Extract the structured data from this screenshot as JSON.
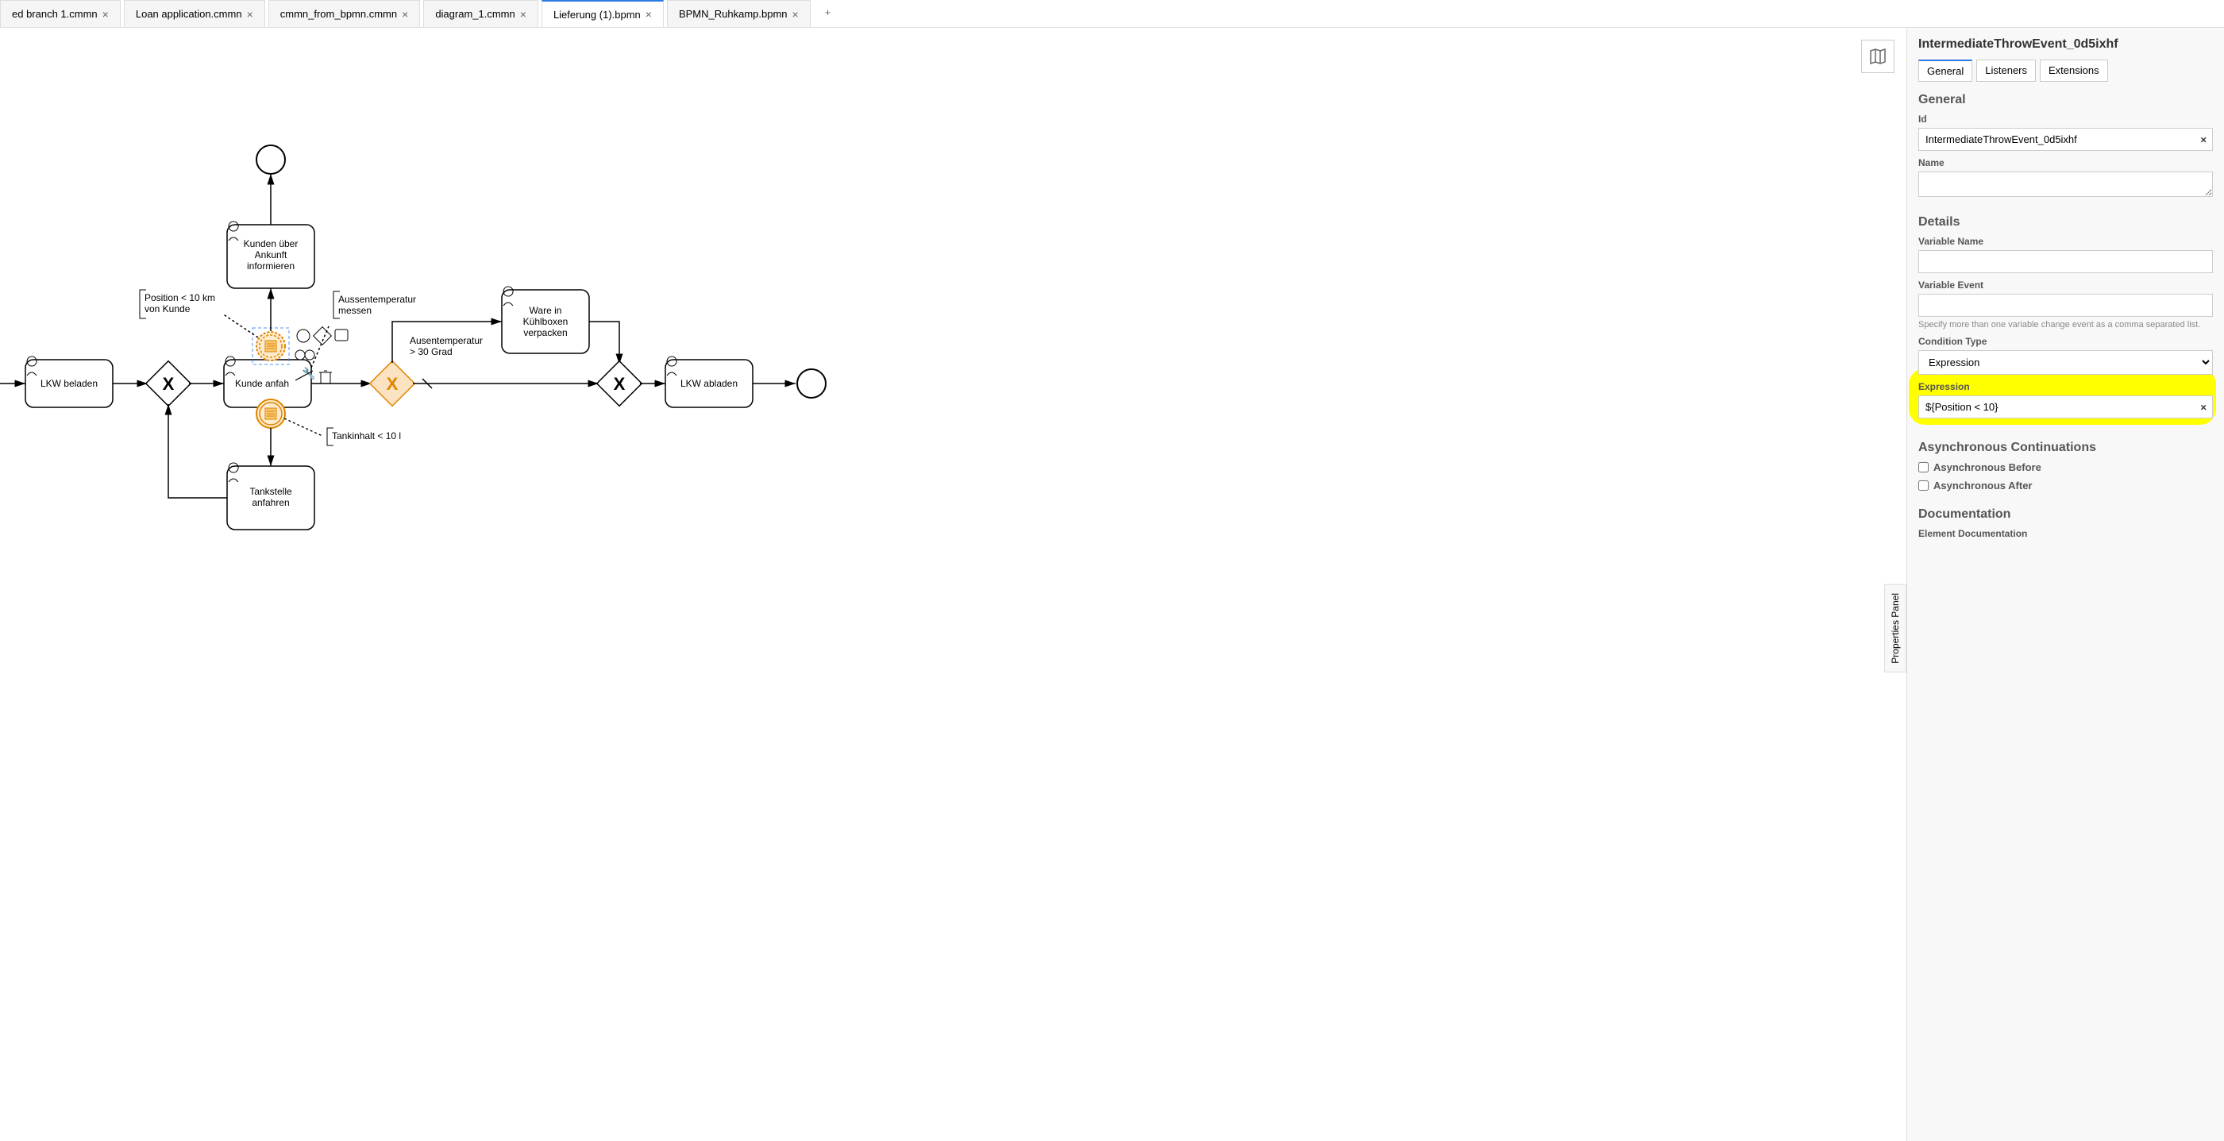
{
  "tabs": [
    {
      "label": "ed branch 1.cmmn",
      "active": false
    },
    {
      "label": "Loan application.cmmn",
      "active": false
    },
    {
      "label": "cmmn_from_bpmn.cmmn",
      "active": false
    },
    {
      "label": "diagram_1.cmmn",
      "active": false
    },
    {
      "label": "Lieferung (1).bpmn",
      "active": true
    },
    {
      "label": "BPMN_Ruhkamp.bpmn",
      "active": false
    }
  ],
  "addTabGlyph": "+",
  "sideTabLabel": "Properties Panel",
  "panel": {
    "title": "IntermediateThrowEvent_0d5ixhf",
    "tabs": {
      "general": "General",
      "listeners": "Listeners",
      "extensions": "Extensions"
    },
    "general": {
      "header": "General",
      "idLabel": "Id",
      "idValue": "IntermediateThrowEvent_0d5ixhf",
      "nameLabel": "Name",
      "nameValue": ""
    },
    "details": {
      "header": "Details",
      "varNameLabel": "Variable Name",
      "varNameValue": "",
      "varEventLabel": "Variable Event",
      "varEventValue": "",
      "varEventHint": "Specify more than one variable change event as a comma separated list.",
      "condTypeLabel": "Condition Type",
      "condTypeValue": "Expression",
      "exprLabel": "Expression",
      "exprValue": "${Position < 10}"
    },
    "async": {
      "header": "Asynchronous Continuations",
      "beforeLabel": "Asynchronous Before",
      "afterLabel": "Asynchronous After"
    },
    "doc": {
      "header": "Documentation",
      "elemDocLabel": "Element Documentation"
    }
  },
  "diagram": {
    "tasks": {
      "lkwBeladen": "LKW beladen",
      "kundenInformieren": "Kunden über\nAnkunft\ninformieren",
      "kundeAnfahren": "Kunde anfah",
      "wareVerpacken": "Ware in\nKühlboxen\nverpacken",
      "lkwAbladen": "LKW abladen",
      "tankstelle": "Tankstelle\nanfahren"
    },
    "gateways": {
      "x1": "X",
      "x2": "X",
      "x3": "X"
    },
    "annotations": {
      "position": "Position < 10 km\nvon Kunde",
      "aussentemp": "Aussentemperatur\nmessen",
      "ausentemp30": "Ausentemperatur\n> 30 Grad",
      "tankinhalt": "Tankinhalt < 10 l"
    }
  }
}
